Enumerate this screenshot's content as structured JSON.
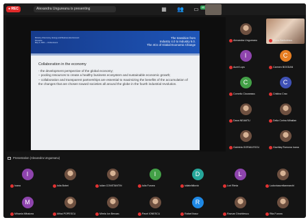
{
  "topbar": {
    "rec_label": "● REC",
    "presenter_text": "Alexandra Ungureanu is presenting",
    "badge": "40"
  },
  "slide": {
    "header_small": [
      "Ministry of Economy, Energy and Business Environment",
      "Romania",
      "May 4, 2021 — Online Event"
    ],
    "title_lines": [
      "The transition from",
      "Industry 4.0 to Industry 5.0.",
      "The 4Cs of Global Economic Change"
    ],
    "heading": "Collaboration in the economy",
    "lines": [
      "- the development perspective of the global economy;",
      "– pooling resources to create a healthy business ecosystem and sustainable economic growth;",
      "– collaboration and transparent partnerships are essential to maximizing the benefits of the accumulation of the changes that are chosen toward societies all around the globe in the fourth industrial revolution."
    ]
  },
  "presentation_label": "Presentation (Alexandra Ungureanu)",
  "colors": {
    "avatar_purple": "#8e44ad",
    "avatar_orange": "#e67e22",
    "avatar_green": "#43a047",
    "avatar_blue": "#3f51b5",
    "avatar_teal": "#26a69a",
    "mic_muted": "#e03232"
  },
  "right_tiles": [
    {
      "name": "Alexandra Ungureanu",
      "kind": "photo"
    },
    {
      "name": "Elena Barbulescu",
      "kind": "video"
    },
    {
      "name": "Aurel Lupu",
      "kind": "avatar",
      "initial": "I",
      "color": "#8e44ad"
    },
    {
      "name": "Carmen BOGDAN",
      "kind": "avatar",
      "initial": "C",
      "color": "#e67e22"
    },
    {
      "name": "Corneliu Ciocarascu",
      "kind": "avatar",
      "initial": "C",
      "color": "#43a047"
    },
    {
      "name": "Cristina Crac",
      "kind": "avatar",
      "initial": "C",
      "color": "#3f51b5"
    },
    {
      "name": "Dana NEAMTU",
      "kind": "photo"
    },
    {
      "name": "Delia Corina Mihailan",
      "kind": "photo"
    },
    {
      "name": "Gabriela GORAILESCU",
      "kind": "photo"
    },
    {
      "name": "Gavrilaş Ramona Ioana",
      "kind": "photo"
    }
  ],
  "grid_row1": [
    {
      "name": "Ioana",
      "kind": "avatar",
      "initial": "I",
      "color": "#8e44ad"
    },
    {
      "name": "Iulia Bobei",
      "kind": "photo"
    },
    {
      "name": "Iulian CONSTANTIN",
      "kind": "photo"
    },
    {
      "name": "Iulia Furcea",
      "kind": "avatar",
      "initial": "I",
      "color": "#43a047"
    },
    {
      "name": "iuliabrătilovici",
      "kind": "avatar",
      "initial": "D",
      "color": "#26a69a"
    },
    {
      "name": "Lori Rimia",
      "kind": "avatar",
      "initial": "L",
      "color": "#8e44ad"
    },
    {
      "name": "Ludovicaurelianmarchi",
      "kind": "photo"
    }
  ],
  "grid_row2": [
    {
      "name": "Mihaela Mihalcea",
      "kind": "avatar",
      "initial": "M",
      "color": "#8e44ad"
    },
    {
      "name": "Mihai POPESCU",
      "kind": "photo"
    },
    {
      "name": "Mirela Ion Bercaru",
      "kind": "photo"
    },
    {
      "name": "Pavel IONESCU",
      "kind": "photo"
    },
    {
      "name": "Rafael Ibacz",
      "kind": "avatar",
      "initial": "R",
      "color": "#1e88e5"
    },
    {
      "name": "Razvan Dinchitescu",
      "kind": "photo"
    },
    {
      "name": "Rita Furcea",
      "kind": "photo"
    }
  ]
}
